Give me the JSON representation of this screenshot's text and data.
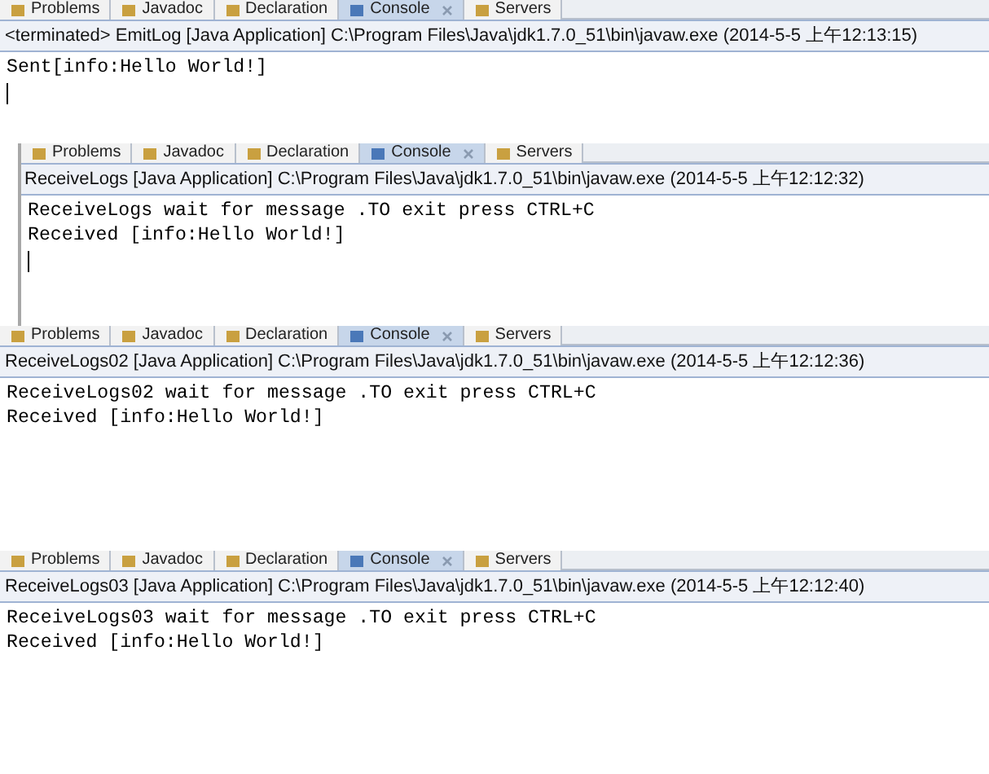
{
  "panels": [
    {
      "tabs": [
        {
          "label": "Problems",
          "selected": false
        },
        {
          "label": "Javadoc",
          "selected": false
        },
        {
          "label": "Declaration",
          "selected": false
        },
        {
          "label": "Console",
          "selected": true
        },
        {
          "label": "Servers",
          "selected": false
        }
      ],
      "header": "<terminated> EmitLog [Java Application] C:\\Program Files\\Java\\jdk1.7.0_51\\bin\\javaw.exe (2014-5-5 上午12:13:15)",
      "lines": [
        "Sent[info:Hello World!]"
      ],
      "cursor": true
    },
    {
      "tabs": [
        {
          "label": "Problems",
          "selected": false
        },
        {
          "label": "Javadoc",
          "selected": false
        },
        {
          "label": "Declaration",
          "selected": false
        },
        {
          "label": "Console",
          "selected": true
        },
        {
          "label": "Servers",
          "selected": false
        }
      ],
      "header": "ReceiveLogs [Java Application] C:\\Program Files\\Java\\jdk1.7.0_51\\bin\\javaw.exe (2014-5-5 上午12:12:32)",
      "lines": [
        "ReceiveLogs wait for message .TO exit press CTRL+C",
        "Received [info:Hello World!]"
      ],
      "cursor": true
    },
    {
      "tabs": [
        {
          "label": "Problems",
          "selected": false
        },
        {
          "label": "Javadoc",
          "selected": false
        },
        {
          "label": "Declaration",
          "selected": false
        },
        {
          "label": "Console",
          "selected": true
        },
        {
          "label": "Servers",
          "selected": false
        }
      ],
      "header": "ReceiveLogs02 [Java Application] C:\\Program Files\\Java\\jdk1.7.0_51\\bin\\javaw.exe (2014-5-5 上午12:12:36)",
      "lines": [
        "ReceiveLogs02 wait for message .TO exit press CTRL+C",
        "Received [info:Hello World!]"
      ],
      "cursor": false
    },
    {
      "tabs": [
        {
          "label": "Problems",
          "selected": false
        },
        {
          "label": "Javadoc",
          "selected": false
        },
        {
          "label": "Declaration",
          "selected": false
        },
        {
          "label": "Console",
          "selected": true
        },
        {
          "label": "Servers",
          "selected": false
        }
      ],
      "header": "ReceiveLogs03 [Java Application] C:\\Program Files\\Java\\jdk1.7.0_51\\bin\\javaw.exe (2014-5-5 上午12:12:40)",
      "lines": [
        "ReceiveLogs03 wait for message .TO exit press CTRL+C",
        "Received [info:Hello World!]"
      ],
      "cursor": false
    }
  ]
}
